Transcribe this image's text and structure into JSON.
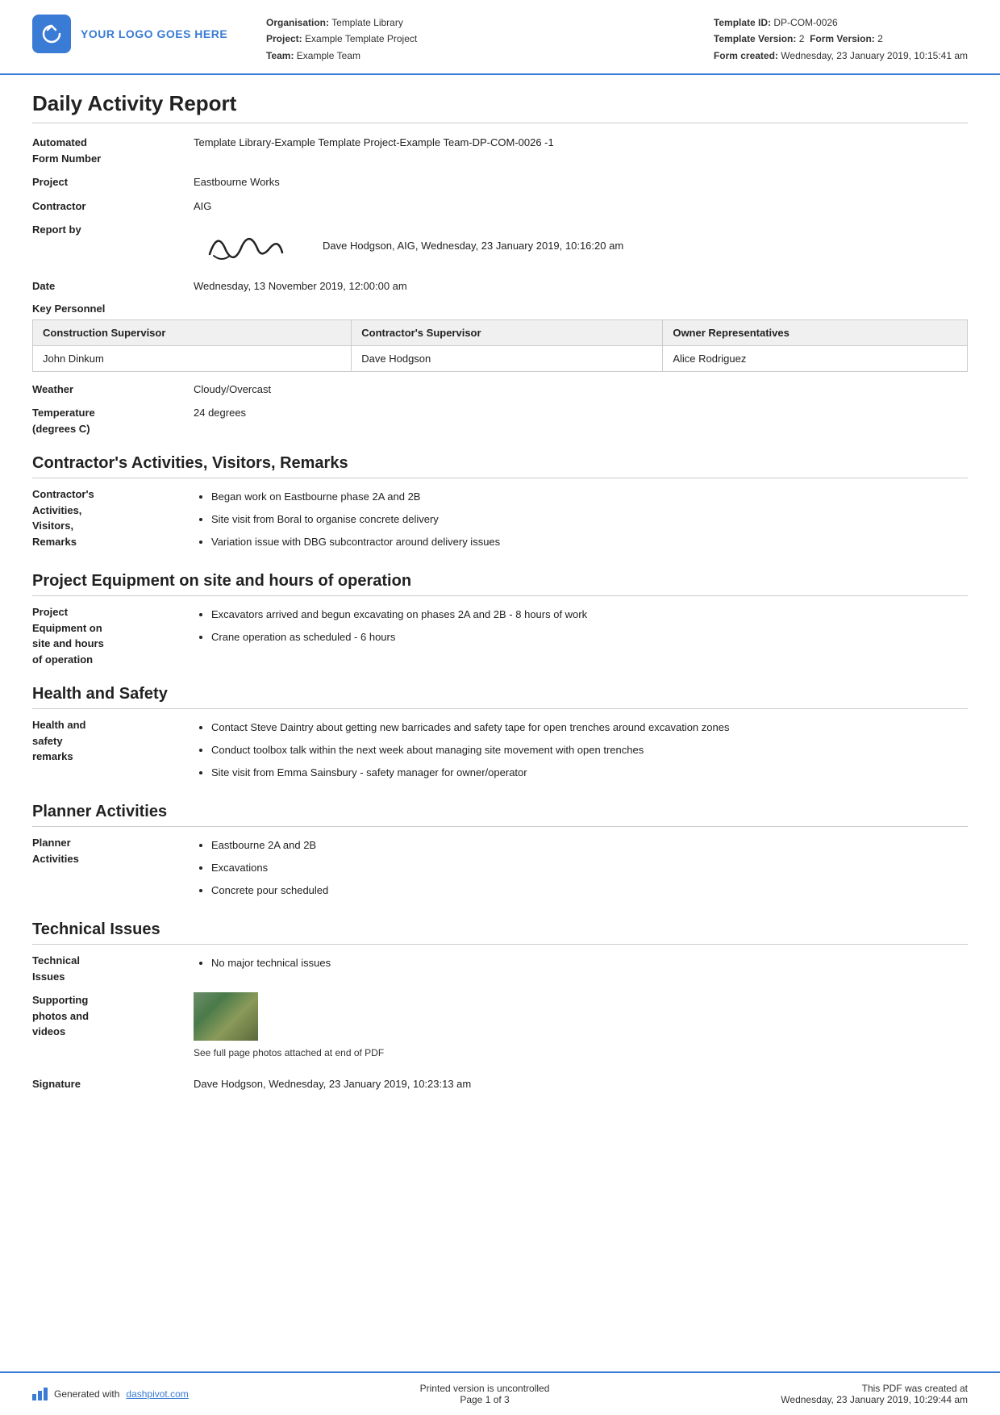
{
  "header": {
    "logo_text": "YOUR LOGO GOES HERE",
    "org_label": "Organisation:",
    "org_value": "Template Library",
    "project_label": "Project:",
    "project_value": "Example Template Project",
    "team_label": "Team:",
    "team_value": "Example Team",
    "template_id_label": "Template ID:",
    "template_id_value": "DP-COM-0026",
    "template_version_label": "Template Version:",
    "template_version_value": "2",
    "form_version_label": "Form Version:",
    "form_version_value": "2",
    "form_created_label": "Form created:",
    "form_created_value": "Wednesday, 23 January 2019, 10:15:41 am"
  },
  "report": {
    "title": "Daily Activity Report",
    "fields": {
      "automated_label": "Automated\nForm Number",
      "automated_value": "Template Library-Example Template Project-Example Team-DP-COM-0026   -1",
      "project_label": "Project",
      "project_value": "Eastbourne Works",
      "contractor_label": "Contractor",
      "contractor_value": "AIG",
      "report_by_label": "Report by",
      "report_by_value": "Dave Hodgson, AIG, Wednesday, 23 January 2019, 10:16:20 am",
      "date_label": "Date",
      "date_value": "Wednesday, 13 November 2019, 12:00:00 am"
    },
    "key_personnel": {
      "label": "Key Personnel",
      "columns": [
        "Construction Supervisor",
        "Contractor's Supervisor",
        "Owner Representatives"
      ],
      "row": [
        "John Dinkum",
        "Dave Hodgson",
        "Alice Rodriguez"
      ]
    },
    "weather": {
      "label": "Weather",
      "value": "Cloudy/Overcast"
    },
    "temperature": {
      "label": "Temperature\n(degrees C)",
      "value": "24 degrees"
    }
  },
  "sections": [
    {
      "id": "contractors-activities",
      "title": "Contractor's Activities, Visitors, Remarks",
      "field_label": "Contractor's\nActivities,\nVisitors,\nRemarks",
      "items": [
        "Began work on Eastbourne phase 2A and 2B",
        "Site visit from Boral to organise concrete delivery",
        "Variation issue with DBG subcontractor around delivery issues"
      ]
    },
    {
      "id": "project-equipment",
      "title": "Project Equipment on site and hours of operation",
      "field_label": "Project\nEquipment on\nsite and hours\nof operation",
      "items": [
        "Excavators arrived and begun excavating on phases 2A and 2B - 8 hours of work",
        "Crane operation as scheduled - 6 hours"
      ]
    },
    {
      "id": "health-safety",
      "title": "Health and Safety",
      "field_label": "Health and\nsafety\nremarks",
      "items": [
        "Contact Steve Daintry about getting new barricades and safety tape for open trenches around excavation zones",
        "Conduct toolbox talk within the next week about managing site movement with open trenches",
        "Site visit from Emma Sainsbury - safety manager for owner/operator"
      ]
    },
    {
      "id": "planner-activities",
      "title": "Planner Activities",
      "field_label": "Planner\nActivities",
      "items": [
        "Eastbourne 2A and 2B",
        "Excavations",
        "Concrete pour scheduled"
      ]
    },
    {
      "id": "technical-issues",
      "title": "Technical Issues",
      "field_label": "Technical\nIssues",
      "items": [
        "No major technical issues"
      ]
    }
  ],
  "supporting_photos": {
    "label": "Supporting\nphotos and\nvideos",
    "caption": "See full page photos attached at end of PDF"
  },
  "signature": {
    "label": "Signature",
    "value": "Dave Hodgson, Wednesday, 23 January 2019, 10:23:13 am"
  },
  "footer": {
    "generated_text": "Generated with ",
    "link_text": "dashpivot.com",
    "center_text": "Printed version is uncontrolled",
    "page_text": "Page 1 of 3",
    "right_text": "This PDF was created at",
    "right_date": "Wednesday, 23 January 2019, 10:29:44 am"
  }
}
